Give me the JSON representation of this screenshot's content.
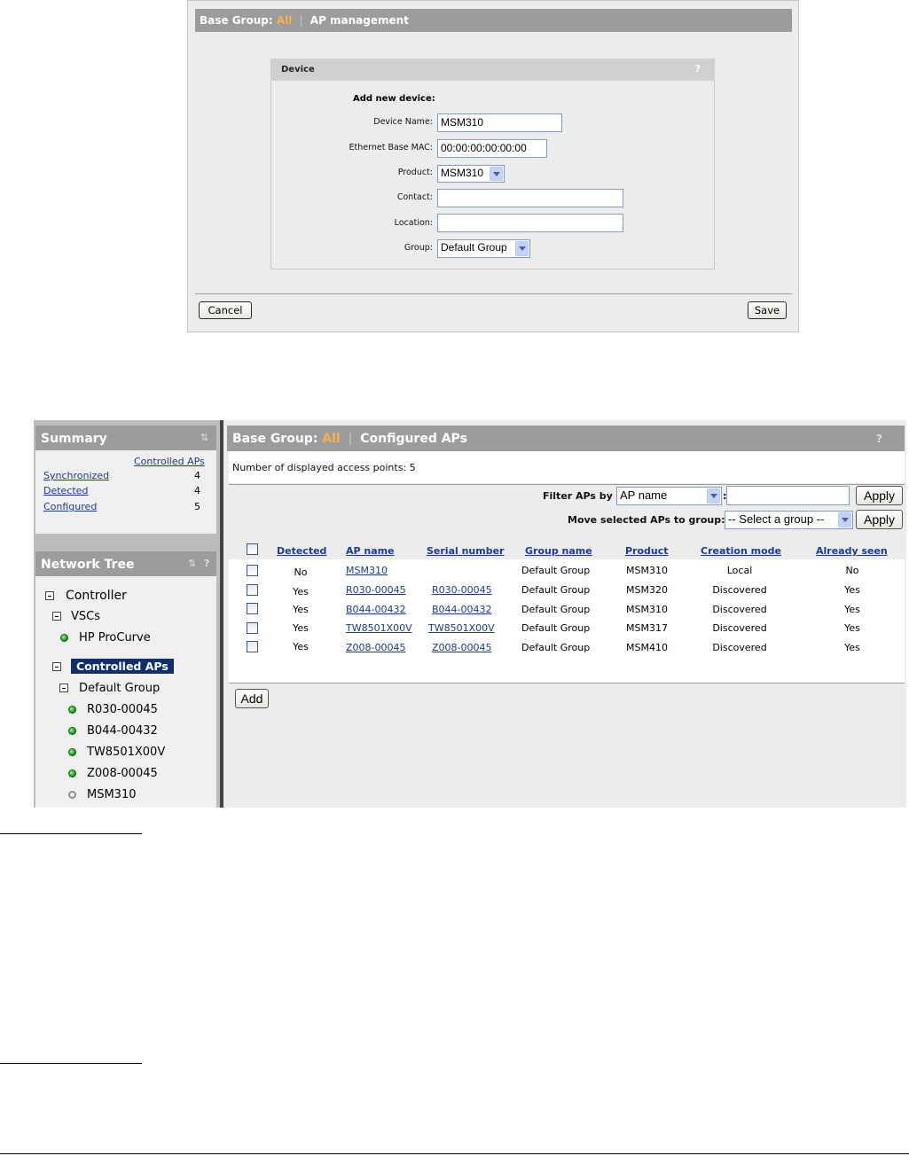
{
  "top_panel": {
    "header": {
      "base_group_label": "Base Group:",
      "base_group_value": "All",
      "separator": "|",
      "section": "AP management"
    },
    "device_box": {
      "title": "Device",
      "help": "?",
      "add_new_label": "Add new device:",
      "fields": {
        "device_name": {
          "label": "Device Name:",
          "value": "MSM310"
        },
        "ethernet_mac": {
          "label": "Ethernet Base MAC:",
          "value": "00:00:00:00:00:00"
        },
        "product": {
          "label": "Product:",
          "value": "MSM310"
        },
        "contact": {
          "label": "Contact:",
          "value": ""
        },
        "location": {
          "label": "Location:",
          "value": ""
        },
        "group": {
          "label": "Group:",
          "value": "Default Group"
        }
      }
    },
    "cancel_label": "Cancel",
    "save_label": "Save"
  },
  "summary": {
    "title": "Summary",
    "column_header": "Controlled APs",
    "rows": [
      {
        "label": "Synchronized",
        "count": "4"
      },
      {
        "label": "Detected",
        "count": "4"
      },
      {
        "label": "Configured",
        "count": "5"
      }
    ]
  },
  "network_tree": {
    "title": "Network Tree",
    "help": "?",
    "controller": "Controller",
    "vscs": "VSCs",
    "vsc_item": "HP ProCurve",
    "controlled_aps": "Controlled APs",
    "default_group": "Default Group",
    "aps": [
      {
        "name": "R030-00045",
        "status": "green"
      },
      {
        "name": "B044-00432",
        "status": "green"
      },
      {
        "name": "TW8501X00V",
        "status": "green"
      },
      {
        "name": "Z008-00045",
        "status": "green"
      },
      {
        "name": "MSM310",
        "status": "gray"
      }
    ]
  },
  "main": {
    "header": {
      "base_group_label": "Base Group:",
      "base_group_value": "All",
      "separator": "|",
      "section": "Configured APs",
      "help": "?"
    },
    "count_text": "Number of displayed access points: 5",
    "filter": {
      "label": "Filter APs by",
      "select_value": "AP name",
      "colon": ":",
      "text_value": "",
      "apply_label": "Apply"
    },
    "move": {
      "label": "Move selected APs to group:",
      "select_value": "-- Select a group --",
      "apply_label": "Apply"
    },
    "table": {
      "columns": [
        "Detected",
        "AP name",
        "Serial number",
        "Group name",
        "Product",
        "Creation mode",
        "Already seen"
      ],
      "rows": [
        {
          "detected": "No",
          "ap_name": "MSM310",
          "serial": "",
          "group": "Default Group",
          "product": "MSM310",
          "mode": "Local",
          "seen": "No"
        },
        {
          "detected": "Yes",
          "ap_name": "R030-00045",
          "serial": "R030-00045",
          "group": "Default Group",
          "product": "MSM320",
          "mode": "Discovered",
          "seen": "Yes"
        },
        {
          "detected": "Yes",
          "ap_name": "B044-00432",
          "serial": "B044-00432",
          "group": "Default Group",
          "product": "MSM310",
          "mode": "Discovered",
          "seen": "Yes"
        },
        {
          "detected": "Yes",
          "ap_name": "TW8501X00V",
          "serial": "TW8501X00V",
          "group": "Default Group",
          "product": "MSM317",
          "mode": "Discovered",
          "seen": "Yes"
        },
        {
          "detected": "Yes",
          "ap_name": "Z008-00045",
          "serial": "Z008-00045",
          "group": "Default Group",
          "product": "MSM410",
          "mode": "Discovered",
          "seen": "Yes"
        }
      ]
    },
    "add_label": "Add"
  },
  "colors": {
    "header_gray": "#9c9c9c",
    "accent_orange": "#f7b04a",
    "link_blue": "#1a3c8e",
    "selected_navy": "#0e2f6d",
    "status_green": "#14a514"
  }
}
